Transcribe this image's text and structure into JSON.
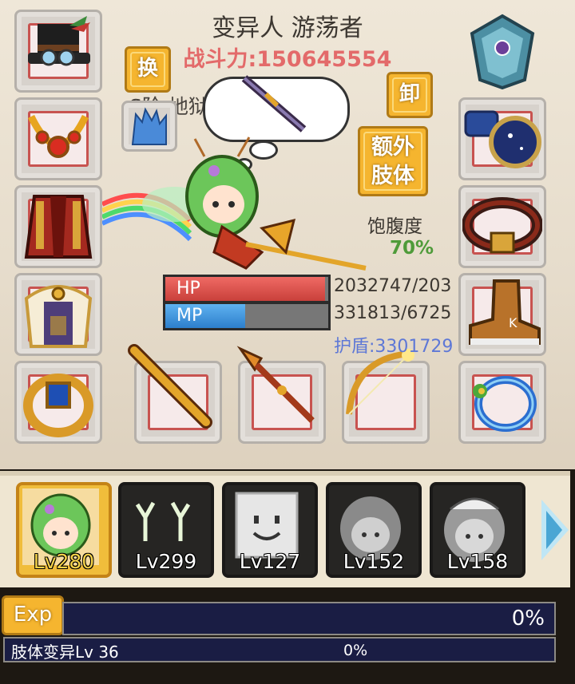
{
  "header": {
    "title": "变异人 游荡者",
    "power": "战斗力:150645554",
    "rank": "S阶 地狱使徒 Lv 100"
  },
  "buttons": {
    "swap": "换",
    "unload": "卸",
    "extra_limb": "额外肢体"
  },
  "equipment": {
    "left": [
      "hat-icon",
      "necklace-icon",
      "cloak-icon",
      "armor-icon",
      "ring-icon"
    ],
    "right": [
      "crest-icon",
      "bracer-icon",
      "belt-icon",
      "boot-icon",
      "bracelet-icon"
    ],
    "weapons": [
      "staff-icon",
      "spear-icon",
      "bow-icon"
    ]
  },
  "satiety": {
    "label": "饱腹度",
    "value": "70%"
  },
  "stats": {
    "hp_label": "HP",
    "hp_text": "2032747/203",
    "hp_fraction": 0.98,
    "mp_label": "MP",
    "mp_text": "331813/6725",
    "mp_fraction": 0.49,
    "shield": "护盾:3301729"
  },
  "roster": [
    {
      "level": "Lv280",
      "portrait": "elf-girl-portrait",
      "active": true
    },
    {
      "level": "Lv299",
      "portrait": "antler-portrait",
      "active": false
    },
    {
      "level": "Lv127",
      "portrait": "block-face-portrait",
      "active": false
    },
    {
      "level": "Lv152",
      "portrait": "boy-portrait",
      "active": false
    },
    {
      "level": "Lv158",
      "portrait": "maid-portrait",
      "active": false
    }
  ],
  "exp": {
    "label": "Exp",
    "percent": "0%"
  },
  "mutation": {
    "label": "肢体变异Lv 36",
    "percent": "0%"
  },
  "colors": {
    "hp": "#d4514c",
    "mp": "#3d8fd6",
    "gold": "#f5b52f",
    "power": "#e36a6a",
    "shield": "#5e78d6",
    "satiety": "#4f9b3a"
  }
}
